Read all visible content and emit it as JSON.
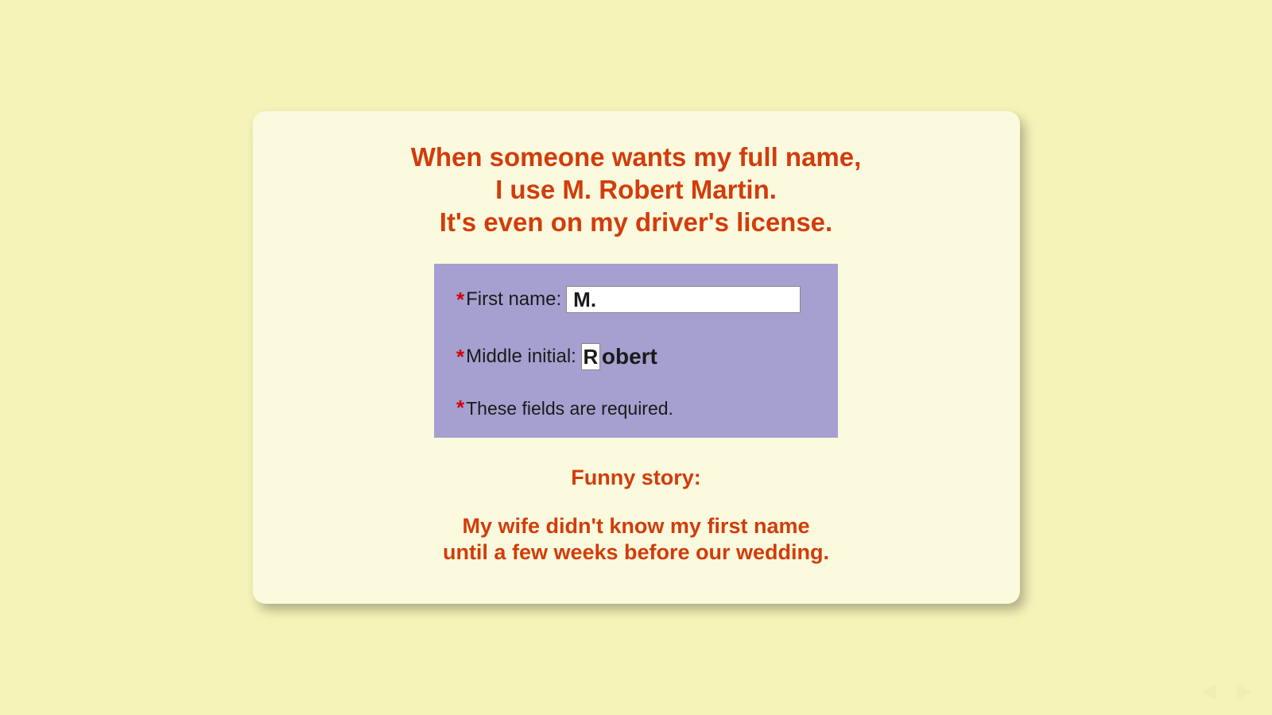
{
  "headline": {
    "line1": "When someone wants my full name,",
    "line2": "I use M. Robert Martin.",
    "line3": "It's even on my driver's license."
  },
  "form": {
    "first_name": {
      "label": "First name:",
      "value": "M."
    },
    "middle_initial": {
      "label": "Middle initial:",
      "value_first_char": "R",
      "value_overflow": "obert"
    },
    "required_note": "These fields are required.",
    "required_marker": "*"
  },
  "footer": {
    "intro": "Funny story:",
    "line1": "My wife didn't know my first name",
    "line2": "until a few weeks before our wedding."
  },
  "colors": {
    "page_bg": "#f5f3b8",
    "card_bg": "#fbfade",
    "accent_text": "#d23c0a",
    "form_bg": "#a5a0d0",
    "required_star": "#d2000a"
  }
}
